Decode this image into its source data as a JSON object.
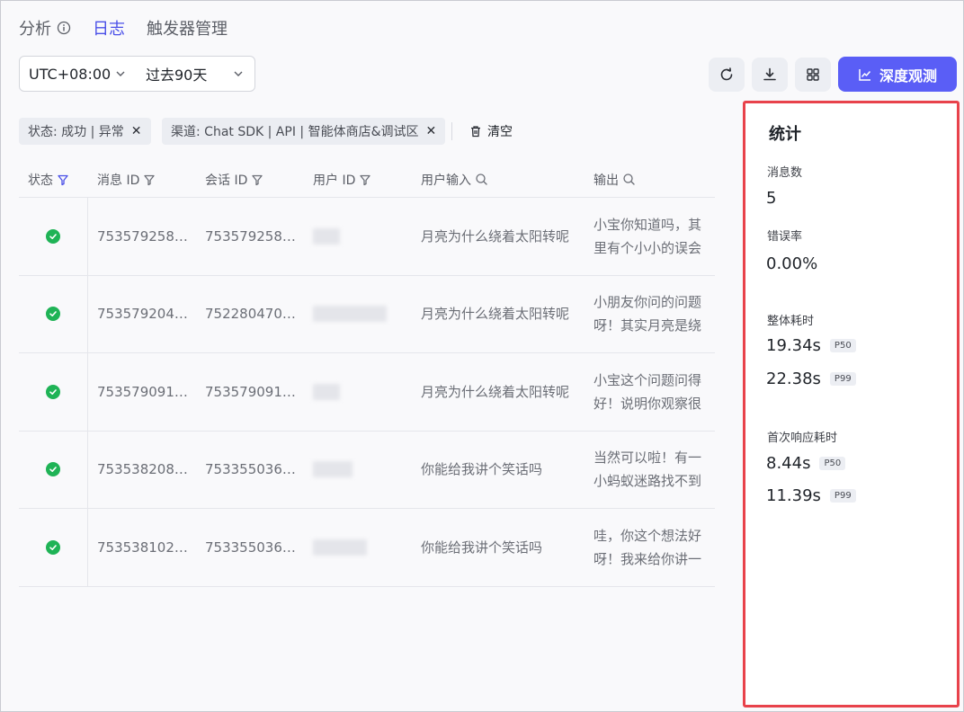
{
  "tabs": [
    {
      "label": "分析",
      "active": false
    },
    {
      "label": "日志",
      "active": true
    },
    {
      "label": "触发器管理",
      "active": false
    }
  ],
  "filters": {
    "timezone": "UTC+08:00",
    "range": "过去90天"
  },
  "toolbar": {
    "refresh_icon": "refresh-icon",
    "download_icon": "download-icon",
    "grid_icon": "grid-icon",
    "primary_label": "深度观测"
  },
  "chips": [
    {
      "text": "状态: 成功 | 异常"
    },
    {
      "text": "渠道: Chat SDK | API | 智能体商店&调试区"
    }
  ],
  "clear_label": "清空",
  "table": {
    "headers": [
      "状态",
      "消息 ID",
      "会话 ID",
      "用户 ID",
      "用户输入",
      "输出"
    ],
    "rows": [
      {
        "status": "success",
        "msg_id": "753579258…",
        "conv_id": "753579258…",
        "input": "月亮为什么绕着太阳转呢",
        "output": "小宝你知道吗，其里有个小小的误会"
      },
      {
        "status": "success",
        "msg_id": "753579204…",
        "conv_id": "752280470…",
        "input": "月亮为什么绕着太阳转呢",
        "output": "小朋友你问的问题呀！其实月亮是绕"
      },
      {
        "status": "success",
        "msg_id": "753579091…",
        "conv_id": "753579091…",
        "input": "月亮为什么绕着太阳转呢",
        "output": "小宝这个问题问得好！说明你观察很"
      },
      {
        "status": "success",
        "msg_id": "753538208…",
        "conv_id": "753355036…",
        "input": "你能给我讲个笑话吗",
        "output": "当然可以啦！有一小蚂蚁迷路找不到"
      },
      {
        "status": "success",
        "msg_id": "753538102…",
        "conv_id": "753355036…",
        "input": "你能给我讲个笑话吗",
        "output": "哇，你这个想法好呀！我来给你讲一"
      }
    ]
  },
  "stats": {
    "title": "统计",
    "msg_count_label": "消息数",
    "msg_count": "5",
    "error_rate_label": "错误率",
    "error_rate": "0.00%",
    "total_latency_label": "整体耗时",
    "total_p50": "19.34s",
    "total_p99": "22.38s",
    "first_resp_label": "首次响应耗时",
    "first_p50": "8.44s",
    "first_p99": "11.39s",
    "p50": "P50",
    "p99": "P99"
  },
  "colors": {
    "accent": "#5a5ef6",
    "active_tab": "#4a4fe8",
    "success": "#1fb356",
    "highlight_border": "#e8424b"
  }
}
